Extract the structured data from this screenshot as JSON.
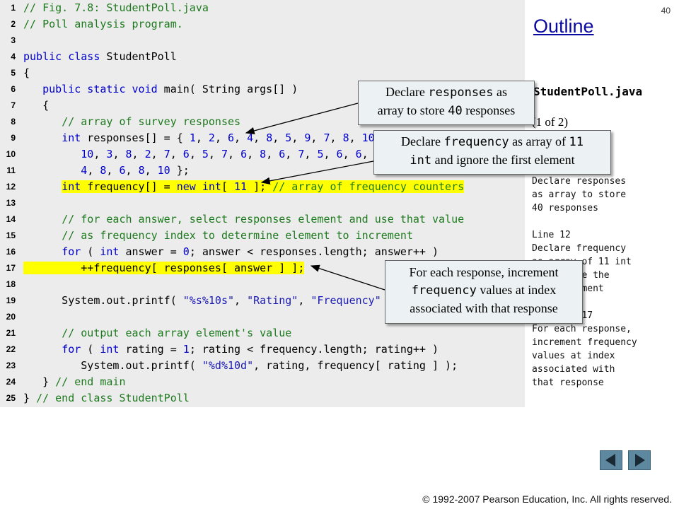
{
  "page_number": "40",
  "outline_title": "Outline",
  "filename": "StudentPoll.java",
  "part": "(1 of 2)",
  "notes_text": "Line 9\nDeclare responses\nas array to store\n40 responses\n\nLine 12\nDeclare frequency\nas array of 11 int\nand ignore the\nfirst element\n\nLines 16-17\nFor each response,\nincrement frequency\nvalues at index\nassociated with\nthat response",
  "code_lines": [
    {
      "num": "1",
      "hl": false,
      "tokens": [
        [
          "c",
          "// Fig. 7.8: StudentPoll.java"
        ]
      ]
    },
    {
      "num": "2",
      "hl": false,
      "tokens": [
        [
          "c",
          "// Poll analysis program."
        ]
      ]
    },
    {
      "num": "3",
      "hl": false,
      "tokens": []
    },
    {
      "num": "4",
      "hl": false,
      "tokens": [
        [
          "k",
          "public class"
        ],
        [
          "d",
          " StudentPoll"
        ]
      ]
    },
    {
      "num": "5",
      "hl": false,
      "tokens": [
        [
          "d",
          "{"
        ]
      ]
    },
    {
      "num": "6",
      "hl": false,
      "tokens": [
        [
          "d",
          "   "
        ],
        [
          "k",
          "public static void"
        ],
        [
          "d",
          " main( String args[] )"
        ]
      ]
    },
    {
      "num": "7",
      "hl": false,
      "tokens": [
        [
          "d",
          "   {"
        ]
      ]
    },
    {
      "num": "8",
      "hl": false,
      "tokens": [
        [
          "d",
          "      "
        ],
        [
          "c",
          "// array of survey responses"
        ]
      ]
    },
    {
      "num": "9",
      "hl": false,
      "tokens": [
        [
          "d",
          "      "
        ],
        [
          "k",
          "int"
        ],
        [
          "d",
          " responses[] = { "
        ],
        [
          "n",
          "1"
        ],
        [
          "d",
          ", "
        ],
        [
          "n",
          "2"
        ],
        [
          "d",
          ", "
        ],
        [
          "n",
          "6"
        ],
        [
          "d",
          ", "
        ],
        [
          "n",
          "4"
        ],
        [
          "d",
          ", "
        ],
        [
          "n",
          "8"
        ],
        [
          "d",
          ", "
        ],
        [
          "n",
          "5"
        ],
        [
          "d",
          ", "
        ],
        [
          "n",
          "9"
        ],
        [
          "d",
          ", "
        ],
        [
          "n",
          "7"
        ],
        [
          "d",
          ", "
        ],
        [
          "n",
          "8"
        ],
        [
          "d",
          ", "
        ],
        [
          "n",
          "10"
        ],
        [
          "d",
          ", "
        ],
        [
          "n",
          "1"
        ],
        [
          "d",
          ", "
        ],
        [
          "n",
          "6"
        ],
        [
          "d",
          ", "
        ],
        [
          "n",
          "3"
        ],
        [
          "d",
          ", "
        ],
        [
          "n",
          "8"
        ],
        [
          "d",
          ", "
        ],
        [
          "n",
          "6"
        ],
        [
          "d",
          ","
        ]
      ]
    },
    {
      "num": "10",
      "hl": false,
      "tokens": [
        [
          "d",
          "         "
        ],
        [
          "n",
          "10"
        ],
        [
          "d",
          ", "
        ],
        [
          "n",
          "3"
        ],
        [
          "d",
          ", "
        ],
        [
          "n",
          "8"
        ],
        [
          "d",
          ", "
        ],
        [
          "n",
          "2"
        ],
        [
          "d",
          ", "
        ],
        [
          "n",
          "7"
        ],
        [
          "d",
          ", "
        ],
        [
          "n",
          "6"
        ],
        [
          "d",
          ", "
        ],
        [
          "n",
          "5"
        ],
        [
          "d",
          ", "
        ],
        [
          "n",
          "7"
        ],
        [
          "d",
          ", "
        ],
        [
          "n",
          "6"
        ],
        [
          "d",
          ", "
        ],
        [
          "n",
          "8"
        ],
        [
          "d",
          ", "
        ],
        [
          "n",
          "6"
        ],
        [
          "d",
          ", "
        ],
        [
          "n",
          "7"
        ],
        [
          "d",
          ", "
        ],
        [
          "n",
          "5"
        ],
        [
          "d",
          ", "
        ],
        [
          "n",
          "6"
        ],
        [
          "d",
          ", "
        ],
        [
          "n",
          "6"
        ],
        [
          "d",
          ", "
        ],
        [
          "n",
          "5"
        ],
        [
          "d",
          ", "
        ],
        [
          "n",
          "6"
        ],
        [
          "d",
          ", "
        ],
        [
          "n",
          "7"
        ],
        [
          "d",
          ", "
        ],
        [
          "n",
          "5"
        ],
        [
          "d",
          ", "
        ],
        [
          "n",
          "6"
        ],
        [
          "d",
          ","
        ]
      ]
    },
    {
      "num": "11",
      "hl": false,
      "tokens": [
        [
          "d",
          "         "
        ],
        [
          "n",
          "4"
        ],
        [
          "d",
          ", "
        ],
        [
          "n",
          "8"
        ],
        [
          "d",
          ", "
        ],
        [
          "n",
          "6"
        ],
        [
          "d",
          ", "
        ],
        [
          "n",
          "8"
        ],
        [
          "d",
          ", "
        ],
        [
          "n",
          "10"
        ],
        [
          "d",
          " };"
        ]
      ]
    },
    {
      "num": "12",
      "hl": true,
      "tokens": [
        [
          "d",
          "      "
        ],
        [
          "k",
          "int"
        ],
        [
          "d",
          " frequency[] = "
        ],
        [
          "k",
          "new int"
        ],
        [
          "d",
          "[ "
        ],
        [
          "n",
          "11"
        ],
        [
          "d",
          " ]; "
        ],
        [
          "c",
          "// array of frequency counters"
        ]
      ]
    },
    {
      "num": "13",
      "hl": false,
      "tokens": []
    },
    {
      "num": "14",
      "hl": false,
      "tokens": [
        [
          "d",
          "      "
        ],
        [
          "c",
          "// for each answer, select responses element and use that value"
        ]
      ]
    },
    {
      "num": "15",
      "hl": false,
      "tokens": [
        [
          "d",
          "      "
        ],
        [
          "c",
          "// as frequency index to determine element to increment"
        ]
      ]
    },
    {
      "num": "16",
      "hl": false,
      "tokens": [
        [
          "d",
          "      "
        ],
        [
          "k",
          "for"
        ],
        [
          "d",
          " ( "
        ],
        [
          "k",
          "int"
        ],
        [
          "d",
          " answer = "
        ],
        [
          "n",
          "0"
        ],
        [
          "d",
          "; answer < responses.length; answer++ )"
        ]
      ]
    },
    {
      "num": "17",
      "hl": true,
      "tokens": [
        [
          "d",
          "         ++frequency[ responses[ answer ] ];"
        ]
      ]
    },
    {
      "num": "18",
      "hl": false,
      "tokens": []
    },
    {
      "num": "19",
      "hl": false,
      "tokens": [
        [
          "d",
          "      System.out.printf( "
        ],
        [
          "s",
          "\"%s%10s\""
        ],
        [
          "d",
          ", "
        ],
        [
          "s",
          "\"Rating\""
        ],
        [
          "d",
          ", "
        ],
        [
          "s",
          "\"Frequency\""
        ],
        [
          "d",
          " );"
        ]
      ]
    },
    {
      "num": "20",
      "hl": false,
      "tokens": []
    },
    {
      "num": "21",
      "hl": false,
      "tokens": [
        [
          "d",
          "      "
        ],
        [
          "c",
          "// output each array element's value"
        ]
      ]
    },
    {
      "num": "22",
      "hl": false,
      "tokens": [
        [
          "d",
          "      "
        ],
        [
          "k",
          "for"
        ],
        [
          "d",
          " ( "
        ],
        [
          "k",
          "int"
        ],
        [
          "d",
          " rating = "
        ],
        [
          "n",
          "1"
        ],
        [
          "d",
          "; rating < frequency.length; rating++ )"
        ]
      ]
    },
    {
      "num": "23",
      "hl": false,
      "tokens": [
        [
          "d",
          "         System.out.printf( "
        ],
        [
          "s",
          "\"%d%10d\""
        ],
        [
          "d",
          ", rating, frequency[ rating ] );"
        ]
      ]
    },
    {
      "num": "24",
      "hl": false,
      "tokens": [
        [
          "d",
          "   } "
        ],
        [
          "c",
          "// end main"
        ]
      ]
    },
    {
      "num": "25",
      "hl": false,
      "tokens": [
        [
          "d",
          "} "
        ],
        [
          "c",
          "// end class StudentPoll"
        ]
      ]
    }
  ],
  "callouts": {
    "responses": {
      "pre": "Declare ",
      "mono": "responses",
      "mid": " as",
      "line2_pre": "array to store ",
      "line2_mono": "40",
      "line2_post": " responses"
    },
    "frequency": {
      "pre": "Declare ",
      "mono": "frequency",
      "mid": " as array of ",
      "mono2": "11",
      "line2_mono": "int",
      "line2_post": " and ignore the first element"
    },
    "increment": {
      "line1": "For each response, increment",
      "mono": "frequency",
      "line2_post": " values at index",
      "line3": "associated with that response"
    }
  },
  "nav": {
    "prev": "previous-slide",
    "next": "next-slide",
    "color": "#5e87a0"
  },
  "footer": "© 1992-2007 Pearson Education, Inc.  All rights reserved."
}
